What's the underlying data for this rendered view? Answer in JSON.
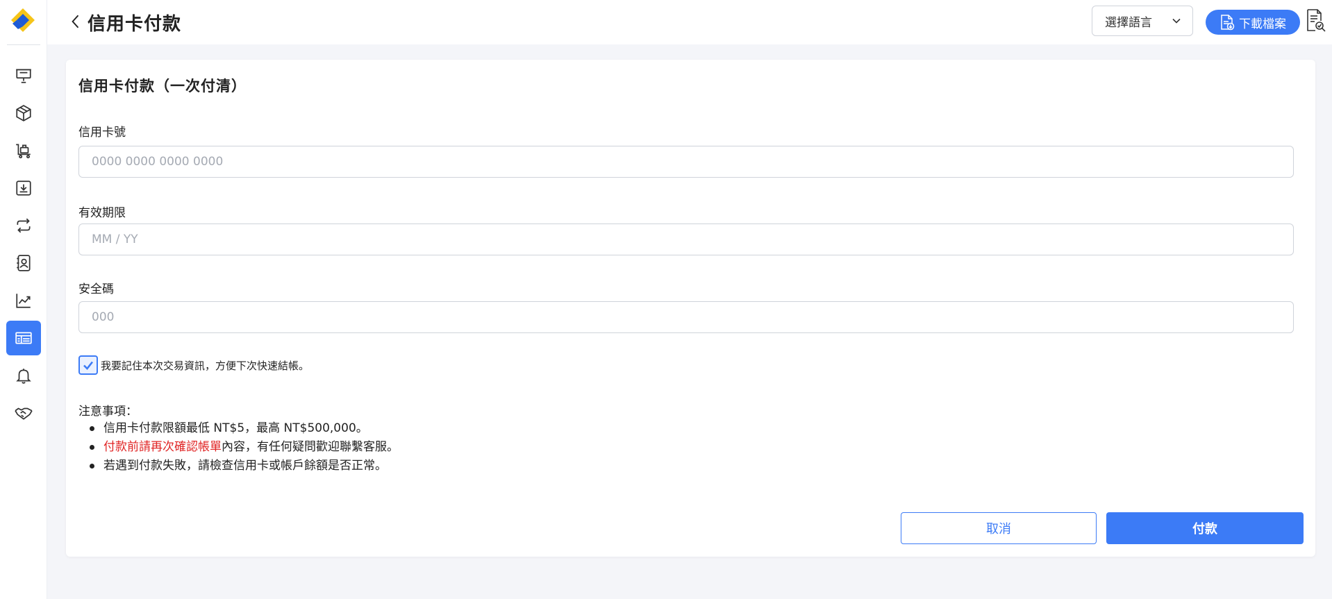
{
  "header": {
    "title": "信用卡付款",
    "language_select": "選擇語言",
    "download_label": "下載檔案"
  },
  "sidebar": {
    "items": [
      {
        "icon": "presentation-board-icon",
        "active": false
      },
      {
        "icon": "package-box-icon",
        "active": false
      },
      {
        "icon": "cart-trolley-icon",
        "active": false
      },
      {
        "icon": "inbox-download-icon",
        "active": false
      },
      {
        "icon": "repeat-icon",
        "active": false
      },
      {
        "icon": "contact-book-icon",
        "active": false
      },
      {
        "icon": "line-chart-icon",
        "active": false
      },
      {
        "icon": "billing-list-icon",
        "active": true
      },
      {
        "icon": "bell-icon",
        "active": false
      },
      {
        "icon": "handshake-icon",
        "active": false
      }
    ]
  },
  "form": {
    "title": "信用卡付款（一次付清）",
    "card_number_label": "信用卡號",
    "card_number_placeholder": "0000 0000 0000 0000",
    "expiry_label": "有效期限",
    "expiry_placeholder": "MM / YY",
    "cvc_label": "安全碼",
    "cvc_placeholder": "000",
    "remember_checked": true,
    "remember_label": "我要記住本次交易資訊，方便下次快速結帳。"
  },
  "notes": {
    "title": "注意事項：",
    "item1": "信用卡付款限額最低 NT$5，最高 NT$500,000。",
    "item2_highlight": "付款前請再次確認帳單",
    "item2_rest": "內容，有任何疑問歡迎聯繫客服。",
    "item3": "若遇到付款失敗，請檢查信用卡或帳戶餘額是否正常。"
  },
  "actions": {
    "cancel_label": "取消",
    "pay_label": "付款"
  },
  "colors": {
    "accent": "#3c7bf6",
    "highlight_text": "#e02424",
    "logo_yellow": "#f5c419",
    "logo_blue": "#1e5bd6"
  }
}
